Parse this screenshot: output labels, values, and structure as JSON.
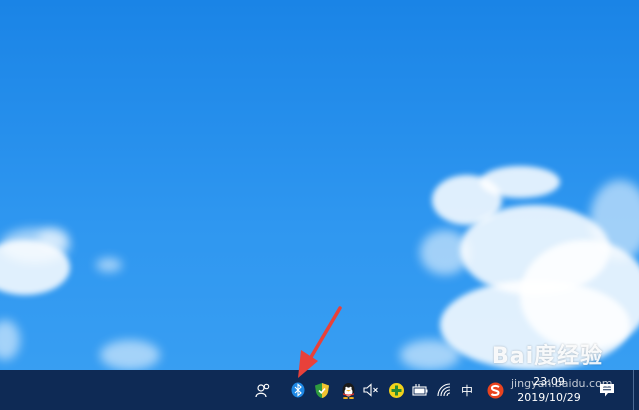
{
  "desktop": {
    "watermark": "Bai度经验",
    "watermark_sub": "jingyan.baidu.com"
  },
  "taskbar": {
    "tray_icons": [
      "people-icon",
      "bluetooth-icon",
      "security-shield-icon",
      "qq-penguin-icon",
      "volume-muted-icon",
      "network-plus-icon",
      "battery-icon",
      "wifi-icon",
      "ime-chinese-icon",
      "sogou-input-icon",
      "action-center-icon"
    ],
    "ime_label": "中",
    "clock": {
      "time": "23:09",
      "date": "2019/10/29"
    }
  },
  "colors": {
    "taskbar": "#0e2a55",
    "desktop_sky": "#2f97f0",
    "arrow": "#e8413a",
    "bluetooth": "#1e88e5"
  }
}
